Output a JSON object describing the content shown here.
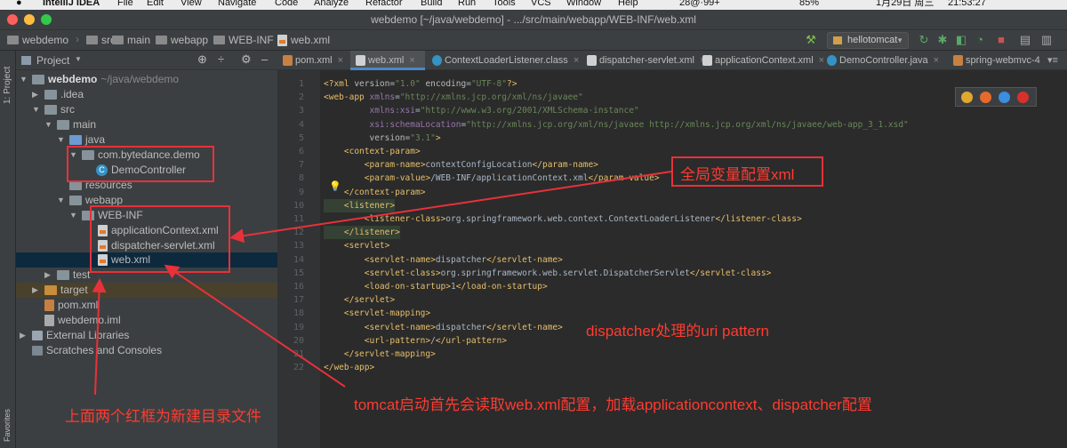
{
  "menubar": {
    "app": "IntelliJ IDEA",
    "items": [
      "File",
      "Edit",
      "View",
      "Navigate",
      "Code",
      "Analyze",
      "Refactor",
      "Build",
      "Run",
      "Tools",
      "VCS",
      "Window",
      "Help"
    ],
    "status": "28@·99+",
    "battery": "85%",
    "date": "1月29日 周三",
    "time": "21:53:27"
  },
  "window": {
    "title": "webdemo [~/java/webdemo] - .../src/main/webapp/WEB-INF/web.xml"
  },
  "breadcrumb": [
    "webdemo",
    "src",
    "main",
    "webapp",
    "WEB-INF",
    "web.xml"
  ],
  "run_config": "hellotomcat",
  "left_strip": {
    "project_label": "1: Project",
    "favorites_label": "Favorites"
  },
  "project_panel": {
    "title": "Project",
    "tree": [
      {
        "label": "webdemo",
        "extra": "~/java/webdemo",
        "expanded": true
      },
      {
        "label": ".idea",
        "expanded": false
      },
      {
        "label": "src",
        "expanded": true
      },
      {
        "label": "main",
        "expanded": true
      },
      {
        "label": "java",
        "expanded": true
      },
      {
        "label": "com.bytedance.demo",
        "expanded": true
      },
      {
        "label": "DemoController"
      },
      {
        "label": "resources"
      },
      {
        "label": "webapp",
        "expanded": true
      },
      {
        "label": "WEB-INF",
        "expanded": true
      },
      {
        "label": "applicationContext.xml"
      },
      {
        "label": "dispatcher-servlet.xml"
      },
      {
        "label": "web.xml",
        "selected": true
      },
      {
        "label": "test",
        "expanded": false
      },
      {
        "label": "target",
        "expanded": false
      },
      {
        "label": "pom.xml"
      },
      {
        "label": "webdemo.iml"
      },
      {
        "label": "External Libraries",
        "expanded": false
      },
      {
        "label": "Scratches and Consoles"
      }
    ]
  },
  "tabs": [
    {
      "label": "pom.xml"
    },
    {
      "label": "web.xml",
      "active": true
    },
    {
      "label": "ContextLoaderListener.class"
    },
    {
      "label": "dispatcher-servlet.xml"
    },
    {
      "label": "applicationContext.xml"
    },
    {
      "label": "DemoController.java"
    },
    {
      "label": "spring-webmvc-4"
    }
  ],
  "code_lines": [
    "<?xml version=\"1.0\" encoding=\"UTF-8\"?>",
    "<web-app xmlns=\"http://xmlns.jcp.org/xml/ns/javaee\"",
    "         xmlns:xsi=\"http://www.w3.org/2001/XMLSchema-instance\"",
    "         xsi:schemaLocation=\"http://xmlns.jcp.org/xml/ns/javaee http://xmlns.jcp.org/xml/ns/javaee/web-app_3_1.xsd\"",
    "         version=\"3.1\">",
    "    <context-param>",
    "        <param-name>contextConfigLocation</param-name>",
    "        <param-value>/WEB-INF/applicationContext.xml</param-value>",
    "    </context-param>",
    "    <listener>",
    "        <listener-class>org.springframework.web.context.ContextLoaderListener</listener-class>",
    "    </listener>",
    "    <servlet>",
    "        <servlet-name>dispatcher</servlet-name>",
    "        <servlet-class>org.springframework.web.servlet.DispatcherServlet</servlet-class>",
    "        <load-on-startup>1</load-on-startup>",
    "    </servlet>",
    "    <servlet-mapping>",
    "        <servlet-name>dispatcher</servlet-name>",
    "        <url-pattern>/</url-pattern>",
    "    </servlet-mapping>",
    "</web-app>"
  ],
  "annotations": {
    "global_config": "全局变量配置xml",
    "dispatcher_uri": "dispatcher处理的uri pattern",
    "tomcat_startup": "tomcat启动首先会读取web.xml配置，加载applicationcontext、dispatcher配置",
    "new_dirs": "上面两个红框为新建目录文件"
  },
  "colors": {
    "annotation": "#ff3b30",
    "tag": "#e8bf6a",
    "string": "#6a8759",
    "namespace": "#9876aa",
    "selection": "#0d293e"
  }
}
